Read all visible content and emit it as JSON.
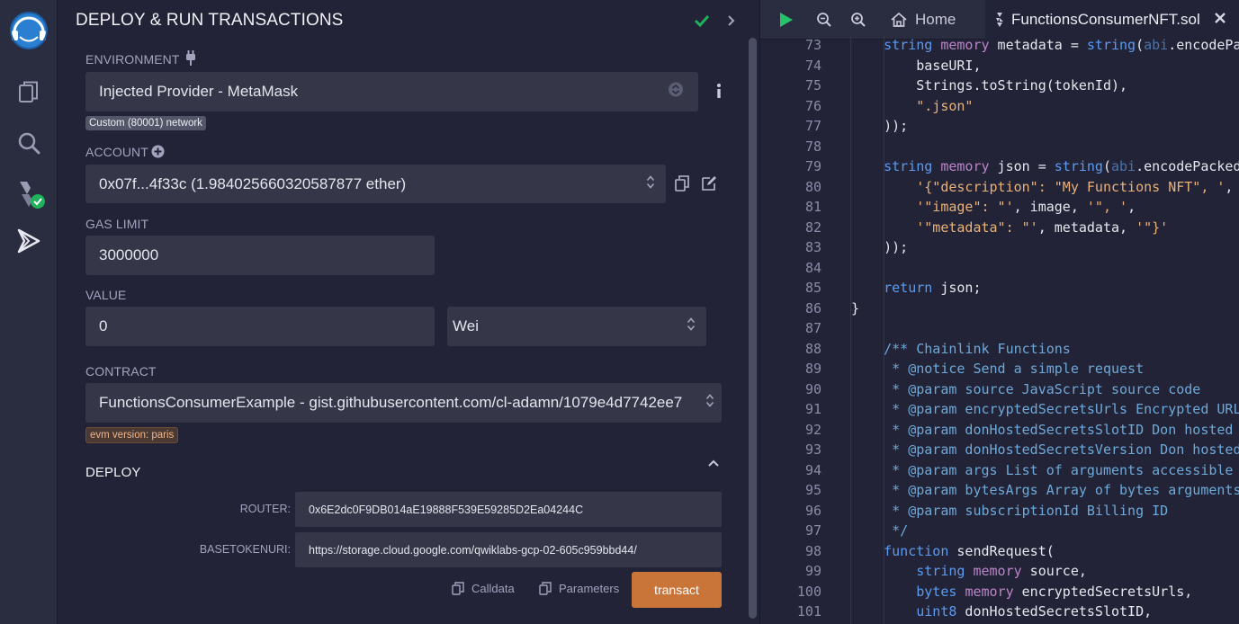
{
  "panel": {
    "title": "DEPLOY & RUN TRANSACTIONS",
    "environment": {
      "label": "ENVIRONMENT",
      "value": "Injected Provider - MetaMask",
      "network_badge": "Custom (80001) network"
    },
    "account": {
      "label": "ACCOUNT",
      "value": "0x07f...4f33c (1.984025660320587877 ether)"
    },
    "gas_limit": {
      "label": "GAS LIMIT",
      "value": "3000000"
    },
    "value": {
      "label": "VALUE",
      "amount": "0",
      "unit": "Wei"
    },
    "contract": {
      "label": "CONTRACT",
      "value": "FunctionsConsumerExample - gist.githubusercontent.com/cl-adamn/1079e4d7742ee7",
      "evm_badge": "evm version: paris"
    },
    "deploy": {
      "label": "DEPLOY",
      "params": [
        {
          "label": "ROUTER:",
          "value": "0x6E2dc0F9DB014aE19888F539E59285D2Ea04244C"
        },
        {
          "label": "BASETOKENURI:",
          "value": "https://storage.cloud.google.com/qwiklabs-gcp-02-605c959bbd44/"
        }
      ],
      "calldata_label": "Calldata",
      "parameters_label": "Parameters",
      "transact_label": "transact"
    }
  },
  "editor": {
    "tabs": [
      {
        "label": "Home"
      },
      {
        "label": "FunctionsConsumerNFT.sol"
      }
    ],
    "lines": [
      {
        "n": "73",
        "t": [
          [
            "    ",
            ""
          ],
          [
            "string",
            "kw"
          ],
          [
            " ",
            ""
          ],
          [
            "memory",
            "mem"
          ],
          [
            " metadata = ",
            ""
          ],
          [
            "string",
            "kw"
          ],
          [
            "(",
            ""
          ],
          [
            "abi",
            "dim"
          ],
          [
            ".encodePa",
            ""
          ]
        ]
      },
      {
        "n": "74",
        "t": [
          [
            "        baseURI,",
            ""
          ]
        ]
      },
      {
        "n": "75",
        "t": [
          [
            "        Strings.toString(tokenId),",
            ""
          ]
        ]
      },
      {
        "n": "76",
        "t": [
          [
            "        ",
            ""
          ],
          [
            "\".json\"",
            "str"
          ]
        ]
      },
      {
        "n": "77",
        "t": [
          [
            "    ));",
            ""
          ]
        ]
      },
      {
        "n": "78",
        "t": []
      },
      {
        "n": "79",
        "t": [
          [
            "    ",
            ""
          ],
          [
            "string",
            "kw"
          ],
          [
            " ",
            ""
          ],
          [
            "memory",
            "mem"
          ],
          [
            " json = ",
            ""
          ],
          [
            "string",
            "kw"
          ],
          [
            "(",
            ""
          ],
          [
            "abi",
            "dim"
          ],
          [
            ".encodePacked",
            ""
          ]
        ]
      },
      {
        "n": "80",
        "t": [
          [
            "        ",
            ""
          ],
          [
            "'{\"description\": \"My Functions NFT\", '",
            "str"
          ],
          [
            ",",
            ""
          ]
        ]
      },
      {
        "n": "81",
        "t": [
          [
            "        ",
            ""
          ],
          [
            "'\"image\": \"'",
            "str"
          ],
          [
            ", image, ",
            ""
          ],
          [
            "'\", '",
            "str"
          ],
          [
            ",",
            ""
          ]
        ]
      },
      {
        "n": "82",
        "t": [
          [
            "        ",
            ""
          ],
          [
            "'\"metadata\": \"'",
            "str"
          ],
          [
            ", metadata, ",
            ""
          ],
          [
            "'\"}'",
            "str"
          ]
        ]
      },
      {
        "n": "83",
        "t": [
          [
            "    ));",
            ""
          ]
        ]
      },
      {
        "n": "84",
        "t": []
      },
      {
        "n": "85",
        "t": [
          [
            "    ",
            ""
          ],
          [
            "return",
            "kw"
          ],
          [
            " json;",
            ""
          ]
        ]
      },
      {
        "n": "86",
        "t": [
          [
            "}",
            ""
          ]
        ]
      },
      {
        "n": "87",
        "t": []
      },
      {
        "n": "88",
        "t": [
          [
            "    ",
            ""
          ],
          [
            "/** Chainlink Functions",
            "cm"
          ]
        ]
      },
      {
        "n": "89",
        "t": [
          [
            "     ",
            ""
          ],
          [
            "* @notice Send a simple request",
            "cm"
          ]
        ]
      },
      {
        "n": "90",
        "t": [
          [
            "     ",
            ""
          ],
          [
            "* @param source JavaScript source code",
            "cm"
          ]
        ]
      },
      {
        "n": "91",
        "t": [
          [
            "     ",
            ""
          ],
          [
            "* @param encryptedSecretsUrls Encrypted URL",
            "cm"
          ]
        ]
      },
      {
        "n": "92",
        "t": [
          [
            "     ",
            ""
          ],
          [
            "* @param donHostedSecretsSlotID Don hosted",
            "cm"
          ]
        ]
      },
      {
        "n": "93",
        "t": [
          [
            "     ",
            ""
          ],
          [
            "* @param donHostedSecretsVersion Don hosted",
            "cm"
          ]
        ]
      },
      {
        "n": "94",
        "t": [
          [
            "     ",
            ""
          ],
          [
            "* @param args List of arguments accessible",
            "cm"
          ]
        ]
      },
      {
        "n": "95",
        "t": [
          [
            "     ",
            ""
          ],
          [
            "* @param bytesArgs Array of bytes arguments",
            "cm"
          ]
        ]
      },
      {
        "n": "96",
        "t": [
          [
            "     ",
            ""
          ],
          [
            "* @param subscriptionId Billing ID",
            "cm"
          ]
        ]
      },
      {
        "n": "97",
        "t": [
          [
            "     ",
            ""
          ],
          [
            "*/",
            "cm"
          ]
        ]
      },
      {
        "n": "98",
        "t": [
          [
            "    ",
            ""
          ],
          [
            "function",
            "kw"
          ],
          [
            " sendRequest(",
            ""
          ]
        ]
      },
      {
        "n": "99",
        "t": [
          [
            "        ",
            ""
          ],
          [
            "string",
            "kw"
          ],
          [
            " ",
            ""
          ],
          [
            "memory",
            "mem"
          ],
          [
            " source,",
            ""
          ]
        ]
      },
      {
        "n": "100",
        "t": [
          [
            "        ",
            ""
          ],
          [
            "bytes",
            "kw"
          ],
          [
            " ",
            ""
          ],
          [
            "memory",
            "mem"
          ],
          [
            " encryptedSecretsUrls,",
            ""
          ]
        ]
      },
      {
        "n": "101",
        "t": [
          [
            "        ",
            ""
          ],
          [
            "uint8",
            "kw"
          ],
          [
            " donHostedSecretsSlotID,",
            ""
          ]
        ]
      }
    ]
  },
  "colors": {
    "accent_transact": "#c97539",
    "success_green": "#1fb25a",
    "run_green": "#27c36a"
  }
}
